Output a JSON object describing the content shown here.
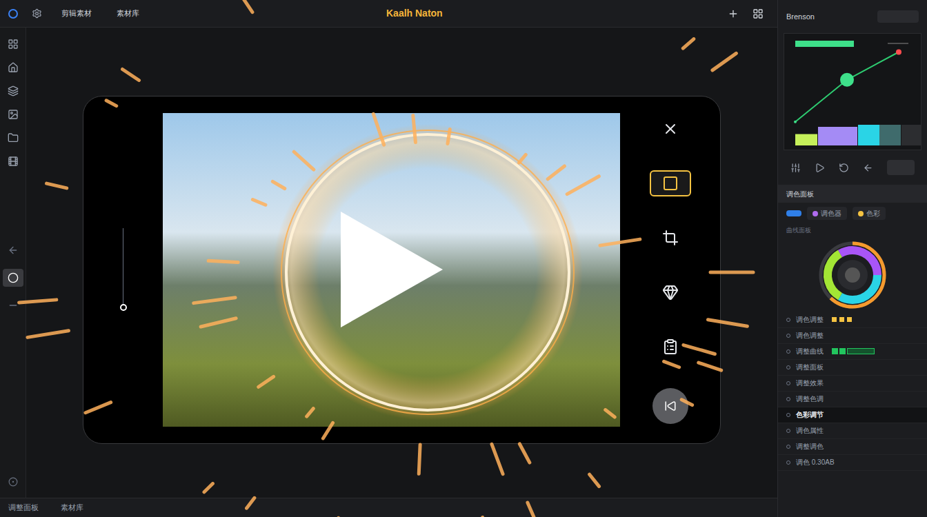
{
  "window": {
    "title": "Kaalh Naton"
  },
  "top_bar": {
    "items": [
      {
        "label": "剪辑素材"
      },
      {
        "label": "素材库"
      }
    ]
  },
  "left_tools": [
    {
      "selected": false
    },
    {
      "selected": false
    },
    {
      "selected": false
    },
    {
      "selected": false
    },
    {
      "selected": false
    },
    {
      "selected": false
    }
  ],
  "left_tools_lower": [
    {
      "selected": false
    },
    {
      "selected": true
    },
    {
      "selected": false
    }
  ],
  "scrubber": {
    "level": 0.0
  },
  "side_tools": [
    {
      "selected": false
    },
    {
      "selected": true
    },
    {
      "selected": false
    },
    {
      "selected": false
    },
    {
      "selected": false
    }
  ],
  "right_panel": {
    "header": "Brenson",
    "chart": {
      "curve": [
        0.02,
        0.55,
        0.9
      ],
      "bars": [
        {
          "value": 0.55,
          "color": "#c6f05a"
        },
        {
          "value": 0.9,
          "color": "#a48bf5"
        },
        {
          "value": 1,
          "color": "#2ad4e6"
        },
        {
          "value": 1,
          "color": "#3f6b6c"
        },
        {
          "value": 1,
          "color": "#2c2d30"
        }
      ]
    },
    "tabs": [
      {
        "label": "调色面板",
        "selected": true
      }
    ],
    "chips": [
      {
        "label": "调色器",
        "selected": false
      },
      {
        "label": "色彩",
        "selected": false
      }
    ],
    "section": "曲线面板",
    "wheel": {
      "level": 0.62
    },
    "rows": [
      {
        "label": "调色调整",
        "kind": "icons"
      },
      {
        "label": "调色调整",
        "kind": "plain"
      },
      {
        "label": "调整曲线",
        "kind": "chips"
      },
      {
        "label": "调整面板",
        "kind": "plain"
      },
      {
        "label": "调整效果",
        "kind": "plain"
      },
      {
        "label": "调整色调",
        "kind": "plain"
      },
      {
        "label": "色彩调节",
        "kind": "highlight"
      },
      {
        "label": "调色属性",
        "kind": "plain"
      },
      {
        "label": "调整调色",
        "kind": "plain"
      },
      {
        "label": "调色 0.30AB",
        "kind": "plain"
      }
    ]
  },
  "bottom_bar": {
    "items": [
      {
        "label": "调整面板"
      },
      {
        "label": "素材库"
      }
    ]
  }
}
